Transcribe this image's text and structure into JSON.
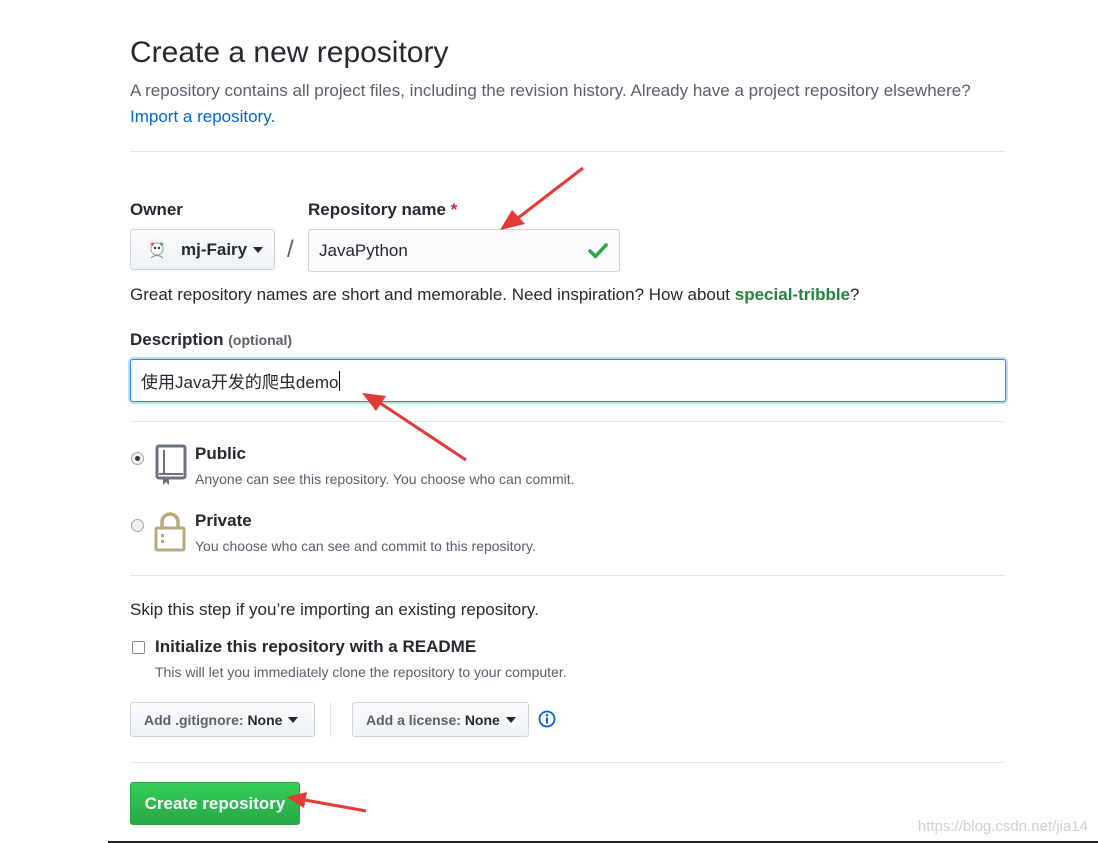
{
  "page": {
    "title": "Create a new repository",
    "lead": "A repository contains all project files, including the revision history. Already have a project repository elsewhere?",
    "import_link": "Import a repository."
  },
  "owner": {
    "label": "Owner",
    "name": "mj-Fairy"
  },
  "repo_name": {
    "label": "Repository name",
    "required_mark": "*",
    "value": "JavaPython"
  },
  "hint": {
    "prefix": "Great repository names are short and memorable. Need inspiration? How about ",
    "suggestion": "special-tribble",
    "suffix": "?"
  },
  "description": {
    "label": "Description",
    "optional": "(optional)",
    "value": "使用Java开发的爬虫demo"
  },
  "visibility": {
    "selected": "public",
    "public": {
      "title": "Public",
      "note": "Anyone can see this repository. You choose who can commit."
    },
    "private": {
      "title": "Private",
      "note": "You choose who can see and commit to this repository."
    }
  },
  "skip_note": "Skip this step if you’re importing an existing repository.",
  "readme": {
    "label": "Initialize this repository with a README",
    "note": "This will let you immediately clone the repository to your computer.",
    "checked": false
  },
  "gitignore": {
    "prefix": "Add .gitignore:",
    "value": "None"
  },
  "license": {
    "prefix": "Add a license:",
    "value": "None"
  },
  "submit": {
    "label": "Create repository"
  },
  "watermark": "https://blog.csdn.net/jia14",
  "colors": {
    "accent": "#28a745",
    "link": "#0366d6",
    "annotation": "#e53935"
  }
}
